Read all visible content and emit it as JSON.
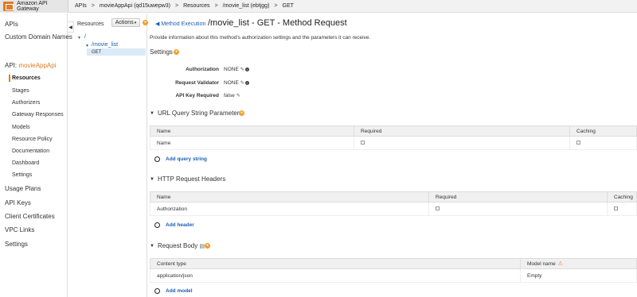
{
  "header": {
    "app_title": "Amazon API Gateway",
    "breadcrumbs": [
      "APIs",
      "movieAppApi (qd15uwepw3)",
      "Resources",
      "/movie_list (ebtjgg)",
      "GET"
    ],
    "separator": ">"
  },
  "sidebar": {
    "apis": "APIs",
    "custom_domains": "Custom Domain Names",
    "api_prefix": "API:",
    "api_name": "movieAppApi",
    "sub_items": [
      "Resources",
      "Stages",
      "Authorizers",
      "Gateway Responses",
      "Models",
      "Resource Policy",
      "Documentation",
      "Dashboard",
      "Settings"
    ],
    "bottom_items": [
      "Usage Plans",
      "API Keys",
      "Client Certificates",
      "VPC Links",
      "Settings"
    ],
    "active_item": "Resources"
  },
  "resources": {
    "title": "Resources",
    "actions_label": "Actions",
    "tree": {
      "root": "/",
      "child": "/movie_list",
      "method": "GET"
    }
  },
  "main": {
    "back_label": "Method Execution",
    "title": "/movie_list - GET - Method Request",
    "description": "Provide information about this method's authorization settings and the parameters it can receive.",
    "settings": {
      "title": "Settings",
      "authorization_label": "Authorization",
      "authorization_value": "NONE",
      "validator_label": "Request Validator",
      "validator_value": "NONE",
      "apikey_label": "API Key Required",
      "apikey_value": "false"
    },
    "query": {
      "title": "URL Query String Parameters",
      "columns": [
        "Name",
        "Required",
        "Caching"
      ],
      "row_name": "Name",
      "add_label": "Add query string"
    },
    "headers": {
      "title": "HTTP Request Headers",
      "columns": [
        "Name",
        "Required",
        "Caching"
      ],
      "row_name": "Authorization",
      "add_label": "Add header"
    },
    "body": {
      "title": "Request Body",
      "columns": [
        "Content type",
        "Model name"
      ],
      "row_type": "application/json",
      "row_model": "Empty",
      "add_label": "Add model"
    }
  },
  "colors": {
    "accent": "#e07b28",
    "link": "#1a5fb4"
  }
}
